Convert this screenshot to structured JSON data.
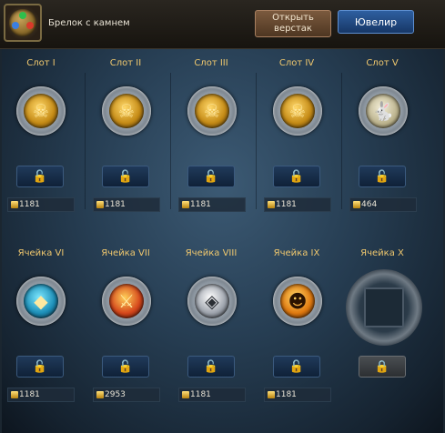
{
  "header": {
    "item_name": "Брелок с камнем",
    "workbench_label": "Открыть верстак",
    "jeweler_label": "Ювелир"
  },
  "slots": [
    {
      "label": "Слот I",
      "gem": "gold-skull-gem-icon",
      "cost": "1181",
      "locked": false
    },
    {
      "label": "Слот II",
      "gem": "gold-skull-gem-icon",
      "cost": "1181",
      "locked": false
    },
    {
      "label": "Слот III",
      "gem": "gold-skull-gem-icon",
      "cost": "1181",
      "locked": false
    },
    {
      "label": "Слот IV",
      "gem": "gold-skull-gem-icon",
      "cost": "1181",
      "locked": false
    },
    {
      "label": "Слот V",
      "gem": "rabbit-gem-icon",
      "cost": "464",
      "locked": false
    }
  ],
  "cells": [
    {
      "label": "Ячейка VI",
      "gem": "blue-crystal-gem-icon",
      "cost": "1181"
    },
    {
      "label": "Ячейка VII",
      "gem": "red-warrior-gem-icon",
      "cost": "2953"
    },
    {
      "label": "Ячейка VIII",
      "gem": "white-crystal-gem-icon",
      "cost": "1181"
    },
    {
      "label": "Ячейка IX",
      "gem": "pumpkin-gem-icon",
      "cost": "1181"
    },
    {
      "label": "Ячейка X",
      "gem": "empty-socket",
      "cost": ""
    }
  ],
  "icons": {
    "unlock": "unlock-icon",
    "lock": "lock-icon",
    "coin": "gold-coin-icon"
  }
}
